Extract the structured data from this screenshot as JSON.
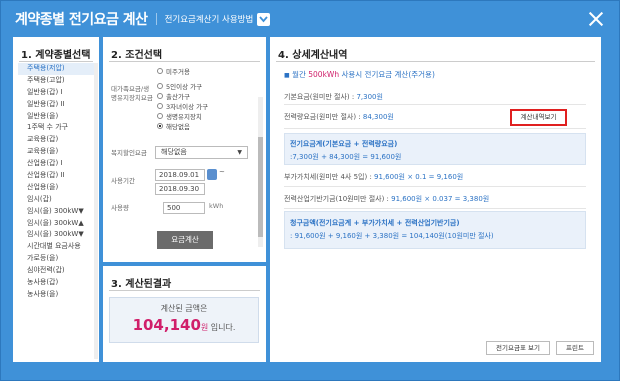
{
  "window": {
    "title": "계약종별 전기요금 계산",
    "guide_link": "전기요금계산기 사용방법"
  },
  "panel1": {
    "heading": "1. 계약종별선택",
    "items": [
      "주택용(저압)",
      "주택용(고압)",
      "일반용(갑) I",
      "일반용(갑) II",
      "일반용(을)",
      "1주택 수 가구",
      "교육용(갑)",
      "교육용(을)",
      "산업용(갑) I",
      "산업용(갑) II",
      "산업용(을)",
      "임시(갑)",
      "임시(을) 300kW▼",
      "임시(을) 300kW▲",
      "임시(을) 300kW▼",
      "시간대별 요금사용",
      "가로등(을)",
      "심야전력(갑)",
      "농사용(갑)",
      "농사용(을)"
    ],
    "selected_index": 0
  },
  "panel2": {
    "heading": "2. 조건선택",
    "top_option": "미주거용",
    "welfare_label": "대가족요금/생명유지장치요금",
    "welfare_options": [
      "5인이상 가구",
      "출산가구",
      "3자녀이상 가구",
      "생명유지장치",
      "해당없음"
    ],
    "welfare_selected": 4,
    "discount_label": "복지할인요금",
    "discount_value": "해당없음",
    "period_label": "사용기간",
    "date_from": "2018.09.01",
    "date_to": "2018.09.30",
    "tilde": "~",
    "usage_label": "사용량",
    "usage_value": "500",
    "usage_unit": "kWh",
    "calc_button": "요금계산"
  },
  "panel3": {
    "heading": "3. 계산된결과",
    "line1": "계산된 금액은",
    "amount": "104,140",
    "unit": "원",
    "suffix": " 입니다."
  },
  "panel4": {
    "heading": "4. 상세계산내역",
    "summary_prefix": "월간 ",
    "summary_usage": "500kWh",
    "summary_suffix": " 사용시 전기요금 계산(주거용)",
    "basic_label": "기본요금(원미만 절사) : ",
    "basic_value": "7,300원",
    "energy_label": "전력량요금(원미만 절사) : ",
    "energy_value": "84,300원",
    "detail_button": "계산내역보기",
    "total_title": "전기요금계(기본요금 + 전력량요금)",
    "total_value": ":7,300원 + 84,300원 = 91,600원",
    "vat_label": "부가가치세(원미만 4사 5입) : ",
    "vat_value": "91,600원 × 0.1 = 9,160원",
    "fund_label": "전력산업기반기금(10원미만 절사) : ",
    "fund_value": "91,600원 × 0.037 = 3,380원",
    "claim_title": "청구금액(전기요금계 + 부가가치세 + 전력산업기반기금)",
    "claim_value": ": 91,600원 + 9,160원 + 3,380원 = 104,140원(10원미만 절사)",
    "table_button": "전기요금표 보기",
    "print_button": "프린트"
  },
  "colors": {
    "header": "#3f91d8",
    "accent": "#2b72c4",
    "amount": "#d01f6a",
    "highlight_border": "#e02020"
  }
}
